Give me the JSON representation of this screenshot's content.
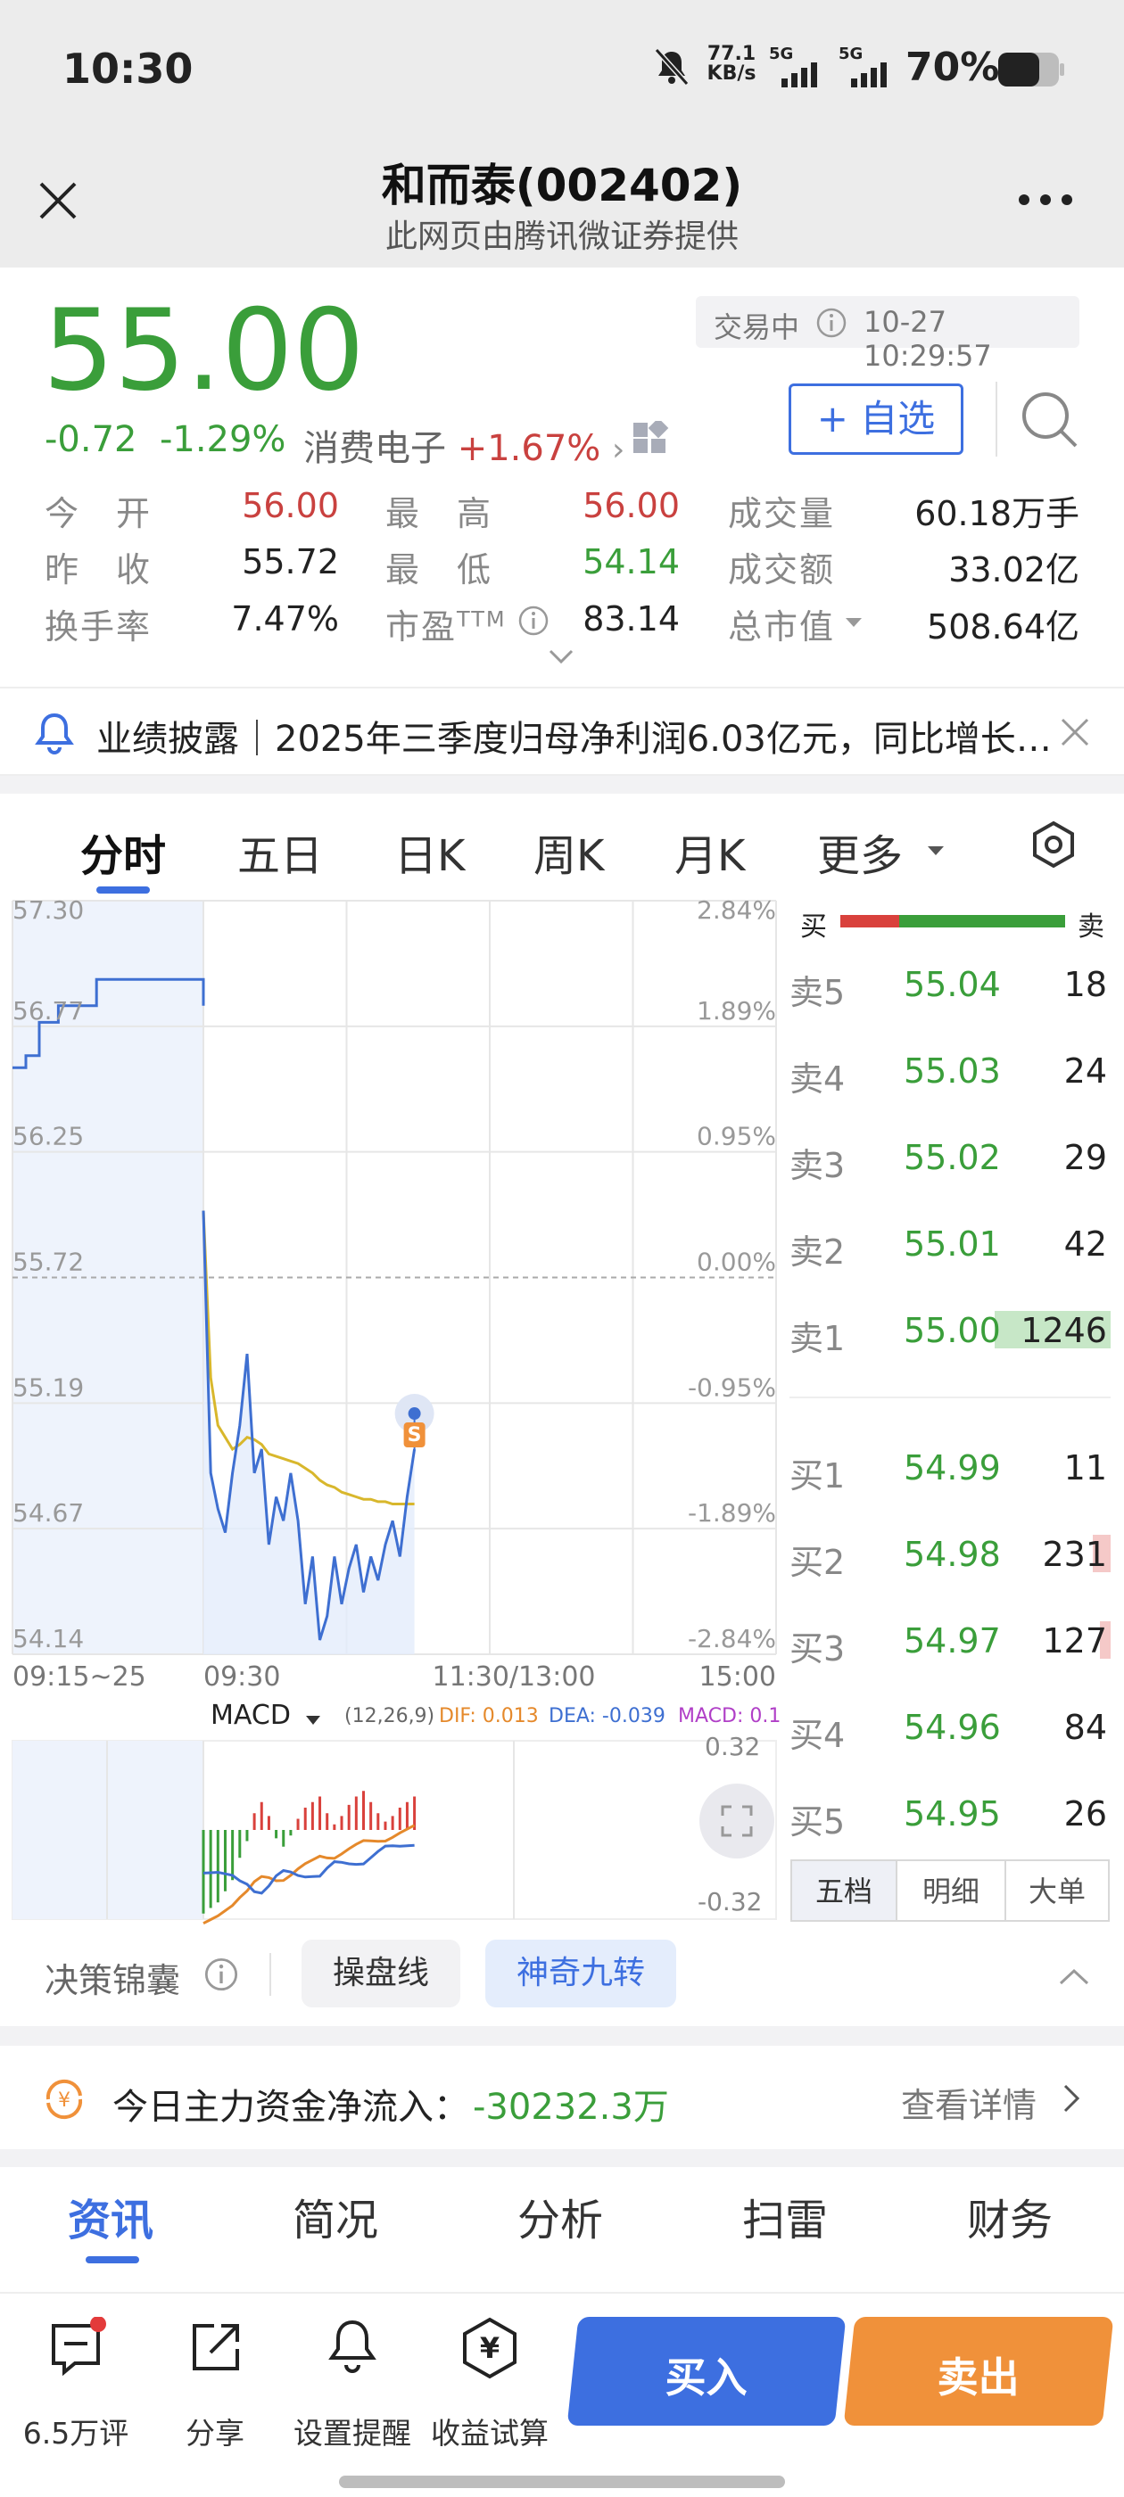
{
  "status_bar": {
    "time": "10:30",
    "net_speed_value": "77.1",
    "net_speed_unit": "KB/s",
    "signal1": "5G",
    "signal2": "5G",
    "battery": "70%"
  },
  "nav": {
    "title": "和而泰(002402)",
    "subtitle": "此网页由腾讯微证券提供"
  },
  "quote": {
    "price": "55.00",
    "change": "-0.72",
    "change_pct": "-1.29%",
    "sector": "消费电子",
    "sector_change": "+1.67%",
    "trade_status": "交易中",
    "timestamp": "10-27 10:29:57",
    "watch_button": "+ 自选",
    "stats": [
      {
        "label": "今　开",
        "value": "56.00",
        "color": "red"
      },
      {
        "label": "最　高",
        "value": "56.00",
        "color": "red"
      },
      {
        "label": "成交量",
        "value": "60.18万手",
        "color": "dark"
      },
      {
        "label": "昨　收",
        "value": "55.72",
        "color": "dark"
      },
      {
        "label": "最　低",
        "value": "54.14",
        "color": "green"
      },
      {
        "label": "成交额",
        "value": "33.02亿",
        "color": "dark"
      },
      {
        "label": "换手率",
        "value": "7.47%",
        "color": "dark"
      },
      {
        "label": "市盈",
        "value": "83.14",
        "color": "dark"
      },
      {
        "label": "总市值",
        "value": "508.64亿",
        "color": "dark"
      }
    ],
    "pe_superscript": "TTM"
  },
  "notice": {
    "text": "业绩披露｜2025年三季度归母净利润6.03亿元，同比增长…"
  },
  "chart_tabs": [
    "分时",
    "五日",
    "日K",
    "周K",
    "月K",
    "更多"
  ],
  "chart_data": {
    "type": "line",
    "y_price_ticks": [
      "57.30",
      "56.77",
      "56.25",
      "55.72",
      "55.19",
      "54.67",
      "54.14"
    ],
    "y_pct_ticks": [
      "2.84%",
      "1.89%",
      "0.95%",
      "0.00%",
      "-0.95%",
      "-1.89%",
      "-2.84%"
    ],
    "x_ticks": [
      "09:15~25",
      "09:30",
      "11:30/13:00",
      "15:00"
    ],
    "ylim": [
      54.14,
      57.3
    ],
    "prev_close": 55.72,
    "auction": [
      [
        0.0,
        56.6
      ],
      [
        0.07,
        56.6
      ],
      [
        0.07,
        56.65
      ],
      [
        0.14,
        56.65
      ],
      [
        0.14,
        56.79
      ],
      [
        0.24,
        56.79
      ],
      [
        0.24,
        56.86
      ],
      [
        0.44,
        56.86
      ],
      [
        0.44,
        56.97
      ],
      [
        1.0,
        56.97
      ],
      [
        1.0,
        56.86
      ]
    ],
    "series": [
      {
        "values": [
          [
            0,
            56.0
          ],
          [
            1,
            54.9
          ],
          [
            2,
            54.75
          ],
          [
            3,
            54.65
          ],
          [
            4,
            54.9
          ],
          [
            5,
            55.1
          ],
          [
            6,
            55.4
          ],
          [
            7,
            54.9
          ],
          [
            8,
            55.0
          ],
          [
            9,
            54.6
          ],
          [
            10,
            54.8
          ],
          [
            11,
            54.7
          ],
          [
            12,
            54.9
          ],
          [
            13,
            54.7
          ],
          [
            14,
            54.35
          ],
          [
            15,
            54.55
          ],
          [
            16,
            54.2
          ],
          [
            17,
            54.3
          ],
          [
            18,
            54.55
          ],
          [
            19,
            54.35
          ],
          [
            20,
            54.5
          ],
          [
            21,
            54.6
          ],
          [
            22,
            54.4
          ],
          [
            23,
            54.55
          ],
          [
            24,
            54.45
          ],
          [
            25,
            54.6
          ],
          [
            26,
            54.7
          ],
          [
            27,
            54.55
          ],
          [
            28,
            54.8
          ],
          [
            29,
            55.0
          ]
        ]
      },
      {
        "values": [
          [
            0,
            56.0
          ],
          [
            1,
            55.3
          ],
          [
            2,
            55.1
          ],
          [
            3,
            55.05
          ],
          [
            4,
            55.0
          ],
          [
            5,
            55.02
          ],
          [
            6,
            55.05
          ],
          [
            7,
            55.04
          ],
          [
            8,
            55.02
          ],
          [
            9,
            54.98
          ],
          [
            10,
            54.97
          ],
          [
            11,
            54.96
          ],
          [
            12,
            54.95
          ],
          [
            13,
            54.94
          ],
          [
            14,
            54.92
          ],
          [
            15,
            54.9
          ],
          [
            16,
            54.87
          ],
          [
            17,
            54.85
          ],
          [
            18,
            54.84
          ],
          [
            19,
            54.82
          ],
          [
            20,
            54.81
          ],
          [
            21,
            54.8
          ],
          [
            22,
            54.79
          ],
          [
            23,
            54.79
          ],
          [
            24,
            54.78
          ],
          [
            25,
            54.78
          ],
          [
            26,
            54.77
          ],
          [
            27,
            54.77
          ],
          [
            28,
            54.77
          ],
          [
            29,
            54.77
          ]
        ]
      }
    ],
    "marker": "S"
  },
  "macd": {
    "label": "MACD",
    "params": "(12,26,9)",
    "dif": "DIF: 0.013",
    "dea": "DEA: -0.039",
    "macd": "MACD: 0.1",
    "y_top": "0.32",
    "y_bottom": "-0.32",
    "bars": [
      -0.3,
      -0.28,
      -0.26,
      -0.22,
      -0.18,
      -0.1,
      -0.04,
      0.06,
      0.1,
      0.05,
      -0.03,
      -0.06,
      -0.02,
      0.04,
      0.08,
      0.1,
      0.12,
      0.06,
      0.02,
      0.05,
      0.09,
      0.12,
      0.14,
      0.1,
      0.06,
      0.03,
      0.05,
      0.08,
      0.1,
      0.12
    ],
    "colors": {
      "up": "#d9413c",
      "down": "#3a9e3a",
      "dif": "#e5892b",
      "dea": "#3e6fd1"
    }
  },
  "order_book": {
    "buy_label": "买",
    "sell_label": "卖",
    "asks": [
      {
        "label": "卖5",
        "price": "55.04",
        "vol": "18"
      },
      {
        "label": "卖4",
        "price": "55.03",
        "vol": "24"
      },
      {
        "label": "卖3",
        "price": "55.02",
        "vol": "29"
      },
      {
        "label": "卖2",
        "price": "55.01",
        "vol": "42"
      },
      {
        "label": "卖1",
        "price": "55.00",
        "vol": "1246"
      }
    ],
    "bids": [
      {
        "label": "买1",
        "price": "54.99",
        "vol": "11"
      },
      {
        "label": "买2",
        "price": "54.98",
        "vol": "231"
      },
      {
        "label": "买3",
        "price": "54.97",
        "vol": "127"
      },
      {
        "label": "买4",
        "price": "54.96",
        "vol": "84"
      },
      {
        "label": "买5",
        "price": "54.95",
        "vol": "26"
      }
    ],
    "tabs": [
      "五档",
      "明细",
      "大单"
    ]
  },
  "decision": {
    "label": "决策锦囊",
    "pill1": "操盘线",
    "pill2": "神奇九转"
  },
  "fund_flow": {
    "label": "今日主力资金净流入：",
    "value": "-30232.3万",
    "detail": "查看详情"
  },
  "bottom_tabs": [
    "资讯",
    "简况",
    "分析",
    "扫雷",
    "财务"
  ],
  "toolbar": {
    "comments": "6.5万评",
    "share": "分享",
    "alert": "设置提醒",
    "calc": "收益试算",
    "buy": "买入",
    "sell": "卖出"
  },
  "colors": {
    "green": "#3a9e3a",
    "red": "#c9413f",
    "accent_blue": "#3d6fe0",
    "sell_orange": "#f0913a"
  }
}
